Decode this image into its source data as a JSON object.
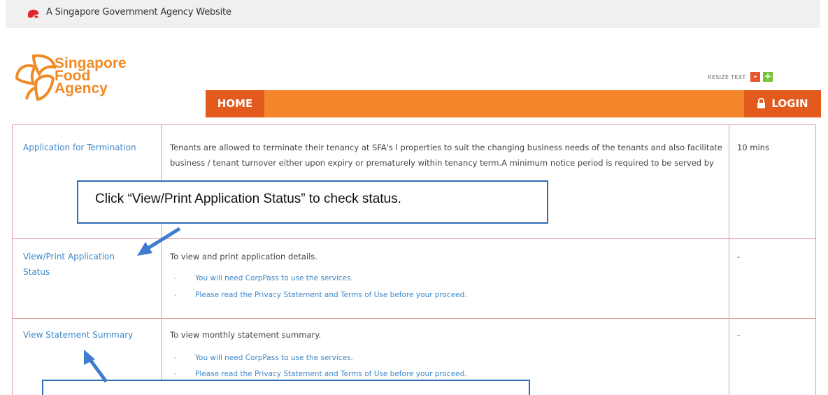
{
  "gov_banner": {
    "text": "A Singapore Government Agency Website"
  },
  "logo": {
    "line1": "Singapore",
    "line2": "Food",
    "line3": "Agency"
  },
  "resize": {
    "label": "RESIZE TEXT",
    "minus": "-",
    "plus": "+"
  },
  "nav": {
    "home": "HOME",
    "login": "LOGIN"
  },
  "rows": [
    {
      "service": "Application for Termination",
      "description": "Tenants are allowed to terminate their tenancy at SFA's l properties to suit the changing business needs of the tenants and also facilitate business / tenant turnover either upon expiry or prematurely within tenancy term.A minimum notice period is required to be served by tenants to MA/SFA.",
      "time": "10 mins"
    },
    {
      "service_line1": "View/Print Application",
      "service_line2": "Status",
      "description": "To view and print application details.",
      "note1": "You will need CorpPass to use the services.",
      "note2": "Please read the Privacy Statement and Terms of Use before your proceed.",
      "bullet": "-",
      "time": "-"
    },
    {
      "service": "View Statement Summary",
      "description": "To view monthly statement  summary.",
      "note1": "You will need CorpPass to use the services.",
      "note2": "Please read the Privacy Statement and Terms of Use before your proceed.",
      "bullet": "-",
      "time": "-"
    }
  ],
  "callouts": {
    "top": "Click “View/Print Application Status” to check status.",
    "bottom": ""
  },
  "colors": {
    "accent_orange": "#f3852b",
    "dark_orange": "#e35a1d",
    "callout_blue": "#2f6db5",
    "link_blue": "#3f87c8"
  }
}
